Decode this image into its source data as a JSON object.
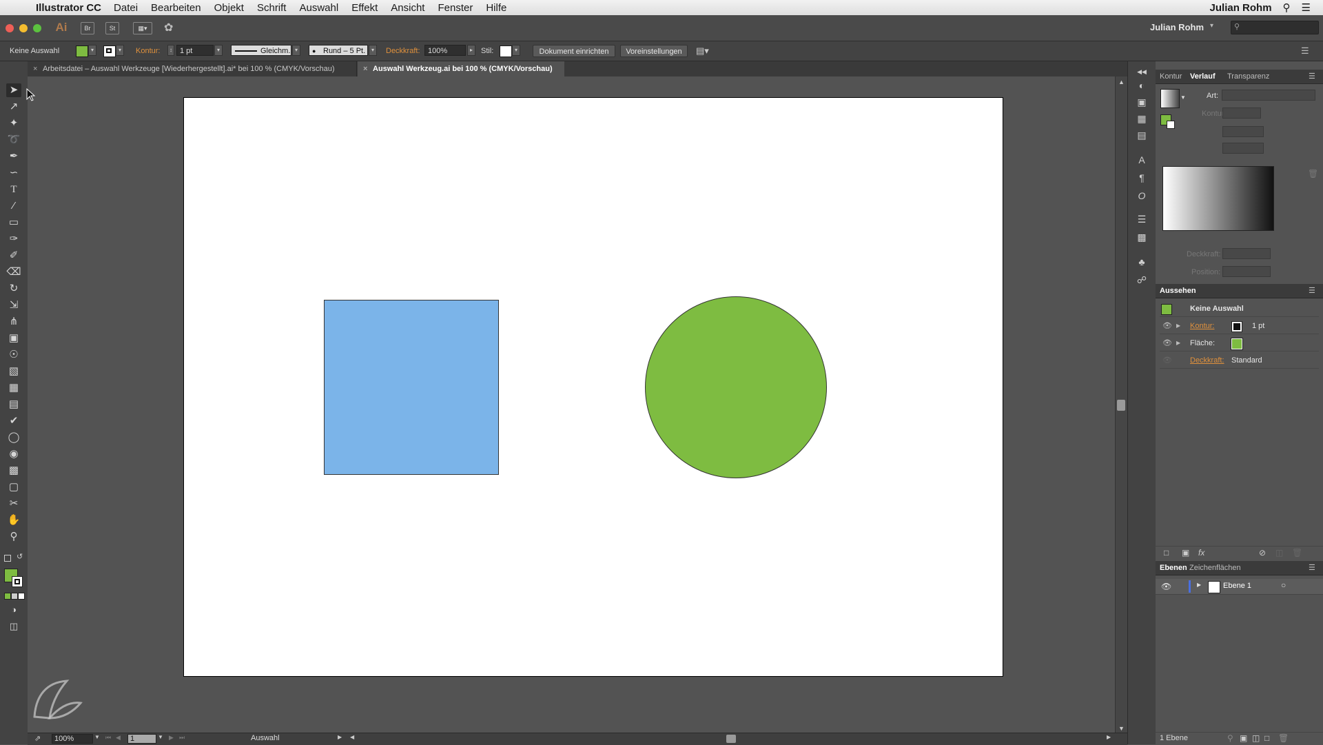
{
  "menubar": {
    "app_name": "Illustrator CC",
    "items": [
      "Datei",
      "Bearbeiten",
      "Objekt",
      "Schrift",
      "Auswahl",
      "Effekt",
      "Ansicht",
      "Fenster",
      "Hilfe"
    ],
    "user": "Julian Rohm"
  },
  "appbar": {
    "app_badge": "Ai",
    "bridge_label": "Br",
    "stock_label": "St",
    "workspace_user": "Julian Rohm"
  },
  "controlbar": {
    "selection_label": "Keine Auswahl",
    "fill_color": "#7ebc41",
    "kontur_label": "Kontur:",
    "stroke_weight": "1 pt",
    "stroke_profile": "Gleichm.",
    "brush": "Rund – 5 Pt.",
    "opacity_label": "Deckkraft:",
    "opacity_value": "100%",
    "style_label": "Stil:",
    "doc_setup_button": "Dokument einrichten",
    "preferences_button": "Voreinstellungen"
  },
  "tabs": [
    {
      "label": "Arbeitsdatei – Auswahl Werkzeuge [Wiederhergestellt].ai* bei 100 % (CMYK/Vorschau)",
      "active": false
    },
    {
      "label": "Auswahl Werkzeug.ai bei 100 % (CMYK/Vorschau)",
      "active": true
    }
  ],
  "artboard": {
    "square_color": "#7bb4e9",
    "circle_color": "#7ebc41"
  },
  "statusbar": {
    "zoom": "100%",
    "artboard_number": "1",
    "tool_status": "Auswahl"
  },
  "gradient_panel": {
    "tabs": [
      "Kontur",
      "Verlauf",
      "Transparenz"
    ],
    "type_label": "Art:",
    "stroke_label": "Kontur:",
    "opacity_label": "Deckkraft:",
    "position_label": "Position:"
  },
  "appearance_panel": {
    "title": "Aussehen",
    "selection": "Keine Auswahl",
    "rows": [
      {
        "label": "Kontur:",
        "value": "1 pt"
      },
      {
        "label": "Fläche:",
        "value": ""
      },
      {
        "label": "Deckkraft:",
        "value": "Standard"
      }
    ]
  },
  "layers_panel": {
    "tabs": [
      "Ebenen",
      "Zeichenflächen"
    ],
    "layer_name": "Ebene 1",
    "footer": "1 Ebene"
  }
}
